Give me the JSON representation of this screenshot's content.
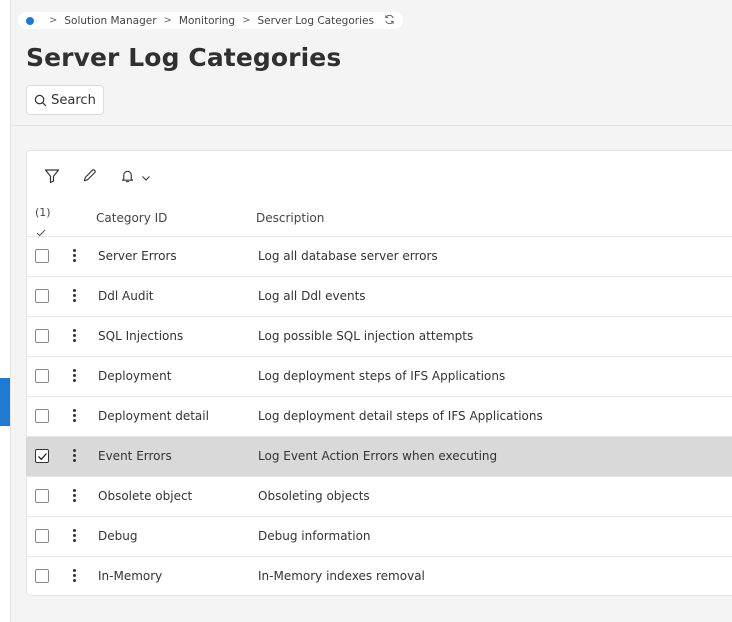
{
  "breadcrumb": {
    "items": [
      "Solution Manager",
      "Monitoring",
      "Server Log Categories"
    ],
    "separator": ">"
  },
  "page": {
    "title": "Server Log Categories"
  },
  "toolbar": {
    "search_label": "Search",
    "icons": [
      "filter-icon",
      "edit-icon",
      "bell-icon",
      "chevron-down-icon"
    ]
  },
  "table": {
    "selected_count": "(1)",
    "columns": [
      "Category ID",
      "Description"
    ],
    "rows": [
      {
        "id": "Server Errors",
        "description": "Log all database server errors",
        "selected": false
      },
      {
        "id": "Ddl Audit",
        "description": "Log all Ddl events",
        "selected": false
      },
      {
        "id": "SQL Injections",
        "description": "Log possible SQL injection attempts",
        "selected": false
      },
      {
        "id": "Deployment",
        "description": "Log deployment steps of IFS Applications",
        "selected": false
      },
      {
        "id": "Deployment detail",
        "description": "Log deployment detail steps of IFS Applications",
        "selected": false
      },
      {
        "id": "Event Errors",
        "description": "Log Event Action Errors when executing",
        "selected": true
      },
      {
        "id": "Obsolete object",
        "description": "Obsoleting objects",
        "selected": false
      },
      {
        "id": "Debug",
        "description": "Debug information",
        "selected": false
      },
      {
        "id": "In-Memory",
        "description": "In-Memory indexes removal",
        "selected": false
      }
    ]
  },
  "colors": {
    "accent": "#1f7ad4",
    "selected_row": "#d9d9d9",
    "background": "#f4f4f4"
  }
}
